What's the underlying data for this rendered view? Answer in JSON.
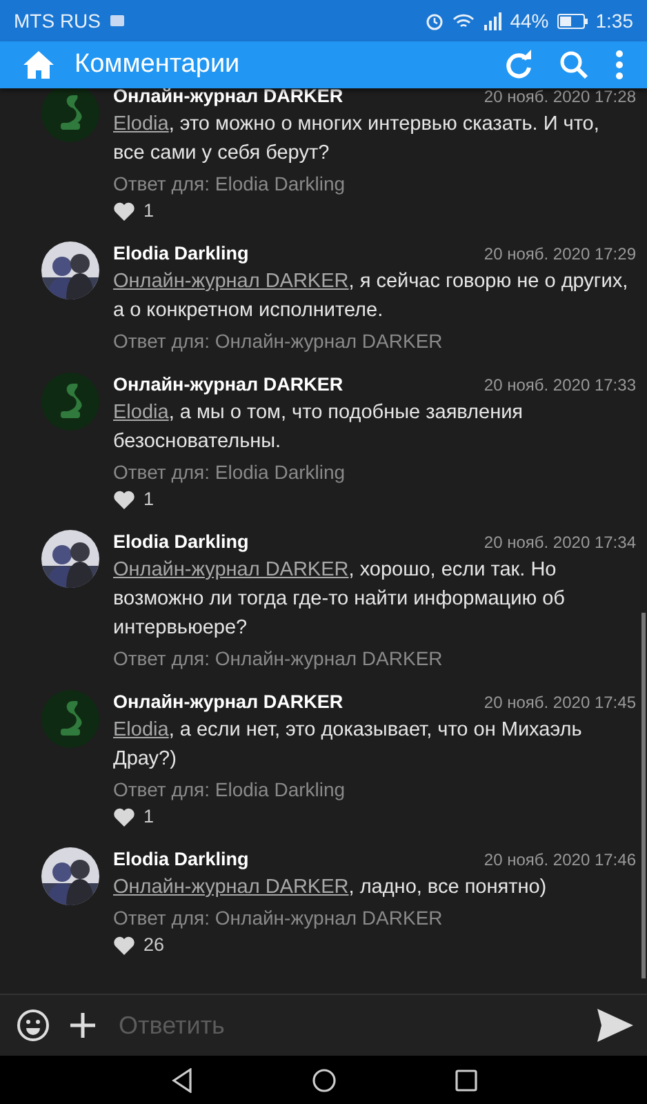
{
  "status_bar": {
    "carrier": "MTS RUS",
    "battery": "44%",
    "time": "1:35"
  },
  "app_bar": {
    "title": "Комментарии"
  },
  "comments": [
    {
      "author": "Онлайн-журнал DARKER",
      "kind": "logo",
      "date": "20 нояб. 2020 17:28",
      "mention": "Elodia",
      "text": ", это можно о многих интервью сказать. И что, все сами у себя берут?",
      "reply_to": "Ответ для: Elodia Darkling",
      "likes": "1"
    },
    {
      "author": "Elodia Darkling",
      "kind": "photo",
      "date": "20 нояб. 2020 17:29",
      "mention": "Онлайн-журнал DARKER",
      "text": ", я сейчас говорю не о других, а о конкретном исполнителе.",
      "reply_to": "Ответ для: Онлайн-журнал DARKER"
    },
    {
      "author": "Онлайн-журнал DARKER",
      "kind": "logo",
      "date": "20 нояб. 2020 17:33",
      "mention": "Elodia",
      "text": ", а мы о том, что подобные заявления безосновательны.",
      "reply_to": "Ответ для: Elodia Darkling",
      "likes": "1"
    },
    {
      "author": "Elodia Darkling",
      "kind": "photo",
      "date": "20 нояб. 2020 17:34",
      "mention": "Онлайн-журнал DARKER",
      "text": ", хорошо, если так. Но возможно ли тогда где-то найти информацию об интервьюере?",
      "reply_to": "Ответ для: Онлайн-журнал DARKER"
    },
    {
      "author": "Онлайн-журнал DARKER",
      "kind": "logo",
      "date": "20 нояб. 2020 17:45",
      "mention": "Elodia",
      "text": ", а если нет, это доказывает, что он Михаэль Драу?)",
      "reply_to": "Ответ для: Elodia Darkling",
      "likes": "1"
    },
    {
      "author": "Elodia Darkling",
      "kind": "photo",
      "date": "20 нояб. 2020 17:46",
      "mention": "Онлайн-журнал DARKER",
      "text": ", ладно, все понятно)",
      "reply_to": "Ответ для: Онлайн-журнал DARKER",
      "likes": "26"
    }
  ],
  "composer": {
    "placeholder": "Ответить"
  }
}
